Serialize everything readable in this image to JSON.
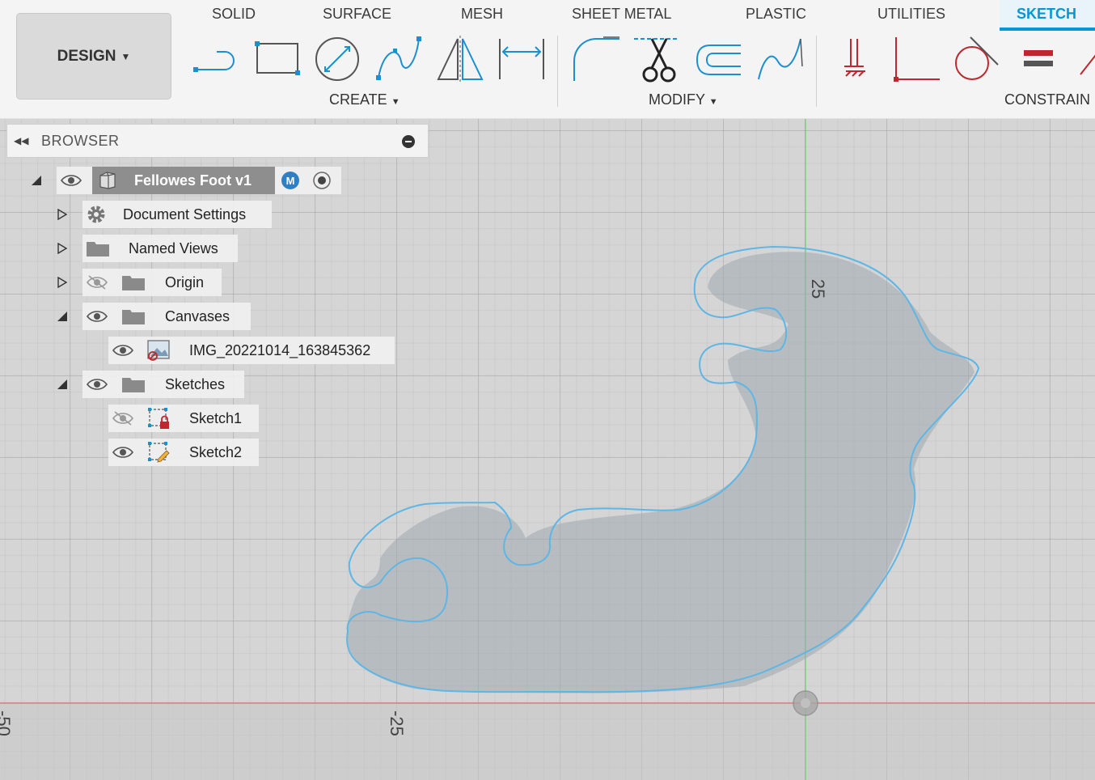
{
  "toolbar": {
    "design_label": "DESIGN",
    "tabs": [
      "SOLID",
      "SURFACE",
      "MESH",
      "SHEET METAL",
      "PLASTIC",
      "UTILITIES",
      "SKETCH"
    ],
    "active_tab": "SKETCH",
    "groups": {
      "create": "CREATE",
      "modify": "MODIFY",
      "constraints": "CONSTRAIN"
    },
    "create_tools": [
      "line-icon",
      "rectangle-icon",
      "circle-icon",
      "spline-icon",
      "mirror-icon",
      "dimension-icon"
    ],
    "modify_tools": [
      "fillet-icon",
      "trim-icon",
      "offset-icon",
      "extend-icon"
    ],
    "constraint_tools": [
      "fix-icon",
      "coincident-icon",
      "tangent-icon",
      "equal-icon",
      "parallel-icon"
    ],
    "accent_color": "#0696d7"
  },
  "browser": {
    "title": "BROWSER",
    "root": {
      "label": "Fellowes Foot v1",
      "badge": "M"
    },
    "items": [
      {
        "label": "Document Settings",
        "icon": "gear-icon"
      },
      {
        "label": "Named Views",
        "icon": "folder-icon"
      },
      {
        "label": "Origin",
        "icon": "folder-icon",
        "visible": false
      },
      {
        "label": "Canvases",
        "icon": "folder-icon",
        "visible": true,
        "expanded": true
      },
      {
        "label": "IMG_20221014_163845362",
        "icon": "canvas-image-icon",
        "visible": true
      },
      {
        "label": "Sketches",
        "icon": "folder-icon",
        "visible": true,
        "expanded": true
      },
      {
        "label": "Sketch1",
        "icon": "sketch-locked-icon",
        "visible": false
      },
      {
        "label": "Sketch2",
        "icon": "sketch-edit-icon",
        "visible": true
      }
    ]
  },
  "viewport": {
    "axis_labels": {
      "y_25": "25",
      "x_minus_25": "-25",
      "x_minus_50": "-50"
    }
  }
}
